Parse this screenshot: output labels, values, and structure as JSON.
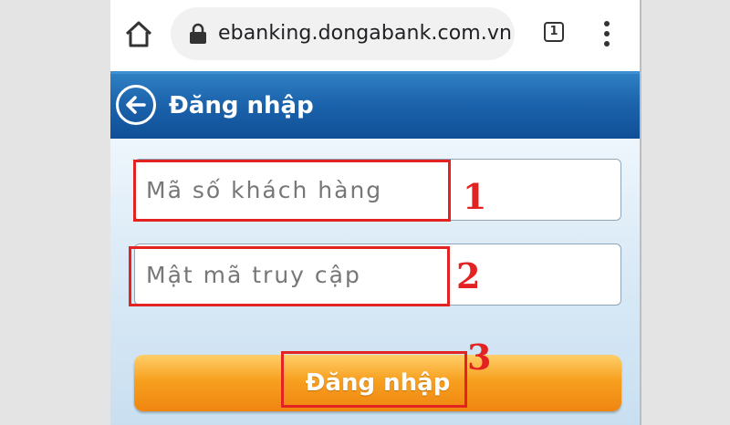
{
  "browser": {
    "url": "ebanking.dongabank.com.vn",
    "tab_count": "1"
  },
  "header": {
    "title": "Đăng nhập"
  },
  "form": {
    "customer_id_placeholder": "Mã số khách hàng",
    "password_placeholder": "Mật mã truy cập",
    "login_label": "Đăng nhập"
  },
  "annotations": {
    "step1": "1",
    "step2": "2",
    "step3": "3"
  },
  "colors": {
    "header_blue": "#1c64ad",
    "button_orange": "#f7a01f",
    "annotation_red": "#e32222"
  }
}
